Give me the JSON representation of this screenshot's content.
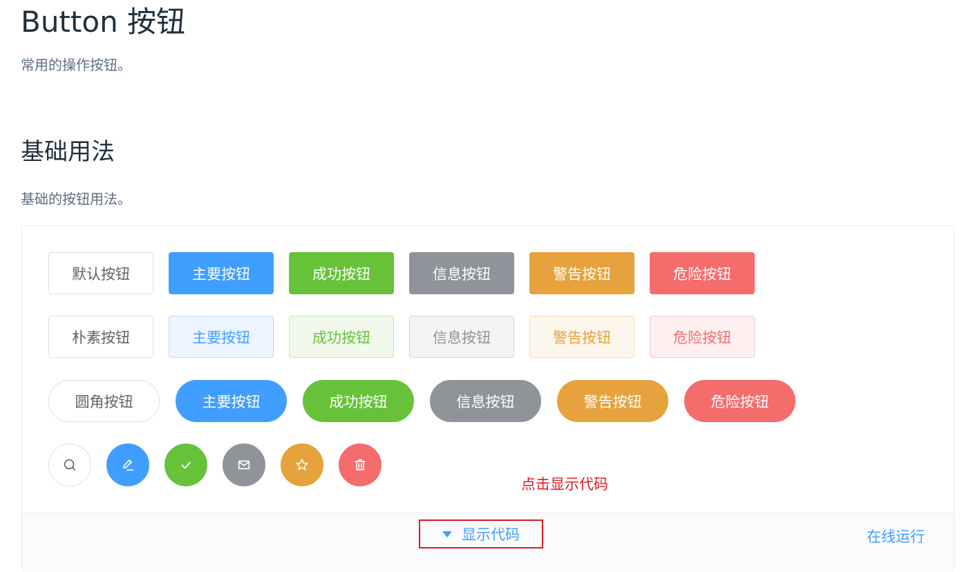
{
  "header": {
    "title": "Button 按钮",
    "description": "常用的操作按钮。"
  },
  "section": {
    "title": "基础用法",
    "description": "基础的按钮用法。"
  },
  "rows": {
    "default": [
      "默认按钮",
      "主要按钮",
      "成功按钮",
      "信息按钮",
      "警告按钮",
      "危险按钮"
    ],
    "plain": [
      "朴素按钮",
      "主要按钮",
      "成功按钮",
      "信息按钮",
      "警告按钮",
      "危险按钮"
    ],
    "round": [
      "圆角按钮",
      "主要按钮",
      "成功按钮",
      "信息按钮",
      "警告按钮",
      "危险按钮"
    ]
  },
  "circle_icons": [
    "search-icon",
    "edit-icon",
    "check-icon",
    "message-icon",
    "star-icon",
    "delete-icon"
  ],
  "colors": {
    "primary": "#409eff",
    "success": "#67c23a",
    "info": "#909399",
    "warning": "#e6a23c",
    "danger": "#f56c6c",
    "annotation": "#e0191e"
  },
  "annotation": "点击显示代码",
  "control": {
    "show_code": "显示代码",
    "online_run": "在线运行"
  }
}
